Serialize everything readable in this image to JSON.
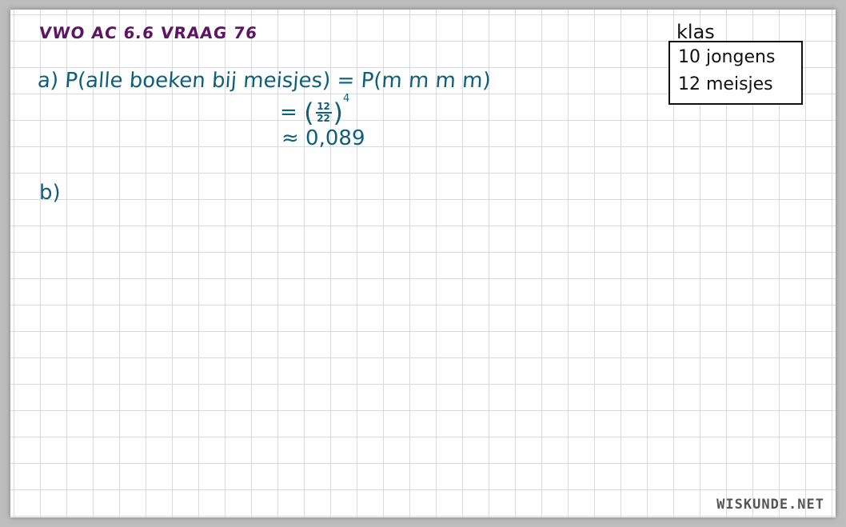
{
  "title": "VWO AC 6.6 VRAAG 76",
  "part_a": {
    "label": "a)",
    "expression": "P(alle boeken bij meisjes) = P(m m m m)",
    "step2_prefix": "=",
    "fraction_numerator": "12",
    "fraction_denominator": "22",
    "exponent": "4",
    "step3": "≈ 0,089"
  },
  "part_b": {
    "label": "b)"
  },
  "klas": {
    "title": "klas",
    "rows": [
      "10 jongens",
      "12 meisjes"
    ]
  },
  "watermark": "WISKUNDE.NET",
  "colors": {
    "title": "#5e1363",
    "work": "#0f5f79",
    "box": "#111111"
  }
}
